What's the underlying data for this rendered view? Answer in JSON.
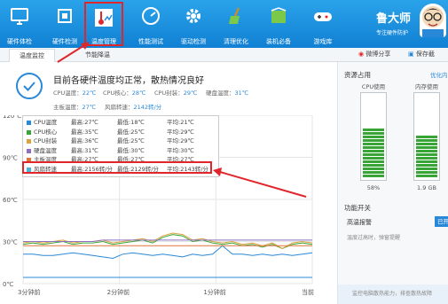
{
  "toolbar": {
    "items": [
      {
        "label": "硬件体检",
        "icon": "monitor-icon"
      },
      {
        "label": "硬件检测",
        "icon": "chip-icon"
      },
      {
        "label": "温度管理",
        "icon": "thermometer-icon",
        "active": true
      },
      {
        "label": "性能测试",
        "icon": "speedometer-icon"
      },
      {
        "label": "驱动检测",
        "icon": "gear-icon"
      },
      {
        "label": "清理优化",
        "icon": "broom-icon"
      },
      {
        "label": "装机必备",
        "icon": "box-icon"
      },
      {
        "label": "游戏库",
        "icon": "gamepad-icon"
      }
    ],
    "brand_name": "鲁大师",
    "brand_slogan": "专注硬件防护"
  },
  "subtabs": {
    "monitor": "温度监控",
    "energy": "节能降温"
  },
  "actions": {
    "share": "微博分享",
    "save": "保存截"
  },
  "status": {
    "title": "目前各硬件温度均正常，散热情况良好",
    "readings": [
      {
        "label": "CPU温度：",
        "value": "22℃"
      },
      {
        "label": "CPU核心：",
        "value": "28℃"
      },
      {
        "label": "CPU封装：",
        "value": "29℃"
      },
      {
        "label": "硬盘温度：",
        "value": "31℃"
      },
      {
        "label": "主板温度：",
        "value": "27℃"
      },
      {
        "label": "风扇转速：",
        "value": "2142转/分"
      }
    ]
  },
  "legend": [
    {
      "name": "CPU温度",
      "max": "最高:27℃",
      "min": "最低:18℃",
      "avg": "平均:21℃",
      "color": "#2a88d8"
    },
    {
      "name": "CPU核心",
      "max": "最高:35℃",
      "min": "最低:25℃",
      "avg": "平均:29℃",
      "color": "#3aa537"
    },
    {
      "name": "CPU封装",
      "max": "最高:36℃",
      "min": "最低:25℃",
      "avg": "平均:29℃",
      "color": "#d9a23a"
    },
    {
      "name": "硬盘温度",
      "max": "最高:31℃",
      "min": "最低:30℃",
      "avg": "平均:30℃",
      "color": "#8e6fc1"
    },
    {
      "name": "主板温度",
      "max": "最高:27℃",
      "min": "最低:27℃",
      "avg": "平均:27℃",
      "color": "#e0733a"
    },
    {
      "name": "风扇转速",
      "max": "最高:2156转/分",
      "min": "最低:2129转/分",
      "avg": "平均:2143转/分",
      "color": "#49b6d9"
    }
  ],
  "chart_data": {
    "type": "line",
    "x": [
      "3分钟前",
      "2分钟前",
      "1分钟前",
      "当前"
    ],
    "y_ticks": [
      "120℃",
      "90℃",
      "60℃",
      "30℃",
      "0℃"
    ],
    "ylim": [
      0,
      120
    ],
    "series": [
      {
        "name": "CPU温度",
        "color": "#2a88d8",
        "values": [
          21,
          21,
          20,
          20,
          21,
          22,
          21,
          20,
          19,
          18,
          21,
          22,
          21,
          20,
          21,
          20,
          19,
          21,
          20,
          21,
          27,
          21,
          21,
          20,
          21,
          20,
          21,
          20,
          21,
          22
        ]
      },
      {
        "name": "CPU核心",
        "color": "#3aa537",
        "values": [
          28,
          29,
          28,
          29,
          30,
          28,
          29,
          29,
          30,
          28,
          29,
          30,
          31,
          29,
          33,
          35,
          34,
          30,
          31,
          29,
          28,
          29,
          27,
          28,
          26,
          28,
          25,
          28,
          29,
          28
        ]
      },
      {
        "name": "CPU封装",
        "color": "#d9a23a",
        "values": [
          29,
          30,
          29,
          30,
          31,
          29,
          30,
          30,
          31,
          29,
          30,
          31,
          32,
          30,
          34,
          36,
          35,
          31,
          32,
          30,
          29,
          30,
          28,
          29,
          27,
          29,
          25,
          29,
          30,
          29
        ]
      },
      {
        "name": "硬盘温度",
        "color": "#8e6fc1",
        "values": [
          30,
          30,
          30,
          30,
          30,
          30,
          30,
          30,
          31,
          31,
          31,
          31,
          31,
          31,
          31,
          31,
          31,
          31,
          31,
          31,
          31,
          31,
          31,
          31,
          31,
          31,
          31,
          31,
          31,
          31
        ]
      },
      {
        "name": "主板温度",
        "color": "#e0733a",
        "values": [
          27,
          27,
          27,
          27,
          27,
          27,
          27,
          27,
          27,
          27,
          27,
          27,
          27,
          27,
          27,
          27,
          27,
          27,
          27,
          27,
          27,
          27,
          27,
          27,
          27,
          27,
          27,
          27,
          27,
          27
        ]
      }
    ]
  },
  "sidebar": {
    "title": "资源占用",
    "link": "优化内",
    "cpu_label": "CPU使用",
    "cpu_value": "58%",
    "cpu_level": 0.58,
    "mem_label": "内存使用",
    "mem_value": "1.9 GB",
    "mem_level": 0.5,
    "features_title": "功能开关",
    "alarm_label": "高温报警",
    "alarm_state": "已开启",
    "alarm_desc": "温度过高时，弹窗提醒",
    "footer": "监控电脑散热能力，排查散热故障"
  }
}
